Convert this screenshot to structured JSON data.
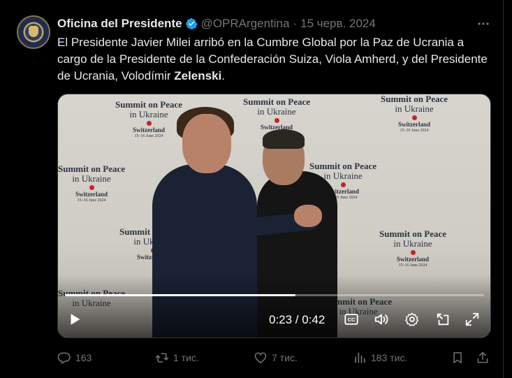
{
  "tweet": {
    "author_name": "Oficina del Presidente",
    "handle": "@OPRArgentina",
    "separator": "·",
    "date": "15 черв. 2024",
    "text_before": "El Presidente Javier Milei arribó en la Cumbre Global por la Paz de Ucrania a cargo de la Presidente de la Confederación Suiza, Viola Amherd, y del Presidente de Ucrania, Volodímir ",
    "text_bold": "Zelenski",
    "text_after": "."
  },
  "backdrop": {
    "line1": "Summit on Peace",
    "line2": "in Ukraine",
    "line3": "Switzerland",
    "line4": "15–16 June 2024"
  },
  "video": {
    "time_display": "0:23 / 0:42",
    "progress": 0.55,
    "caption_label": "CC"
  },
  "actions": {
    "replies": "163",
    "reposts": "1 тис.",
    "likes": "7 тис.",
    "views": "183 тис."
  },
  "colors": {
    "background": "#000000",
    "text": "#e7e9ea",
    "muted": "#71767b",
    "verified": "#1d9bf0"
  }
}
